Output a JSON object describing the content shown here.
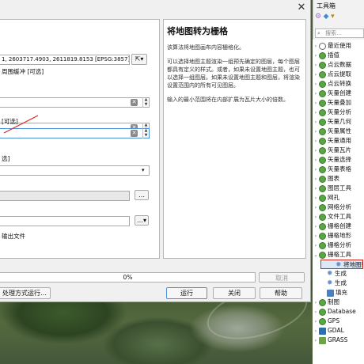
{
  "dialog": {
    "extent_value": "1, 2603717.4903, 2611819.8153 [EPSG:3857]",
    "buffer_label": "周围缓冲 [可选]",
    "field3_label": "[可选]",
    "field4_label": "选]",
    "output_label": "输出文件",
    "progress": "0%",
    "cancel": "取消",
    "batch": "处理方式运行…",
    "run": "运行",
    "close": "关闭",
    "help": "帮助"
  },
  "help": {
    "title": "将地图转为栅格",
    "p1": "该算法将地图画布内容栅格化。",
    "p2": "可以选择地图主题渲染一组预先确定的图层，每个图层都具有定义的样式。或者，如果未设置地图主题，也可以选择一组图层。如果未设置地图主题和图层，将渲染设置范围内的所有可见图层。",
    "p3": "输入的最小范围将在内部扩展为瓦片大小的倍数。"
  },
  "toolbox": {
    "title": "工具箱",
    "search_placeholder": "搜索…",
    "items": [
      {
        "label": "最近使用",
        "arrow": "›",
        "icon": "clock"
      },
      {
        "label": "插值",
        "arrow": "›",
        "icon": "q"
      },
      {
        "label": "点云数据",
        "arrow": "›",
        "icon": "q"
      },
      {
        "label": "点云提取",
        "arrow": "›",
        "icon": "q"
      },
      {
        "label": "点云转换",
        "arrow": "›",
        "icon": "q"
      },
      {
        "label": "矢量创建",
        "arrow": "›",
        "icon": "q"
      },
      {
        "label": "矢量叠加",
        "arrow": "›",
        "icon": "q"
      },
      {
        "label": "矢量分析",
        "arrow": "›",
        "icon": "q"
      },
      {
        "label": "矢量几何",
        "arrow": "›",
        "icon": "q"
      },
      {
        "label": "矢量属性",
        "arrow": "›",
        "icon": "q"
      },
      {
        "label": "矢量通用",
        "arrow": "›",
        "icon": "q"
      },
      {
        "label": "矢量瓦片",
        "arrow": "›",
        "icon": "q"
      },
      {
        "label": "矢量选择",
        "arrow": "›",
        "icon": "q"
      },
      {
        "label": "矢量表格",
        "arrow": "›",
        "icon": "q"
      },
      {
        "label": "图表",
        "arrow": "›",
        "icon": "q"
      },
      {
        "label": "图层工具",
        "arrow": "›",
        "icon": "q"
      },
      {
        "label": "网孔",
        "arrow": "›",
        "icon": "q"
      },
      {
        "label": "网络分析",
        "arrow": "›",
        "icon": "q"
      },
      {
        "label": "文件工具",
        "arrow": "›",
        "icon": "q"
      },
      {
        "label": "栅格创建",
        "arrow": "›",
        "icon": "q"
      },
      {
        "label": "栅格地形",
        "arrow": "›",
        "icon": "q"
      },
      {
        "label": "栅格分析",
        "arrow": "›",
        "icon": "q"
      },
      {
        "label": "栅格工具",
        "arrow": "⌄",
        "icon": "q"
      },
      {
        "label": "将地图转为栅格",
        "arrow": "",
        "icon": "gear",
        "sub": true,
        "selected": true
      },
      {
        "label": "生成",
        "arrow": "",
        "icon": "gear",
        "sub": true
      },
      {
        "label": "生成",
        "arrow": "",
        "icon": "gear",
        "sub": true
      },
      {
        "label": "填充",
        "arrow": "",
        "icon": "grid",
        "sub": true
      },
      {
        "label": "制图",
        "arrow": "›",
        "icon": "q"
      },
      {
        "label": "Database",
        "arrow": "›",
        "icon": "q"
      },
      {
        "label": "GPS",
        "arrow": "›",
        "icon": "q"
      },
      {
        "label": "GDAL",
        "arrow": "›",
        "icon": "gdal"
      },
      {
        "label": "GRASS",
        "arrow": "›",
        "icon": "grass"
      }
    ]
  },
  "colors": {
    "focus_border": "#4a90d9",
    "annotation_red": "#d9261c",
    "qgis_green": "#5aa544"
  }
}
